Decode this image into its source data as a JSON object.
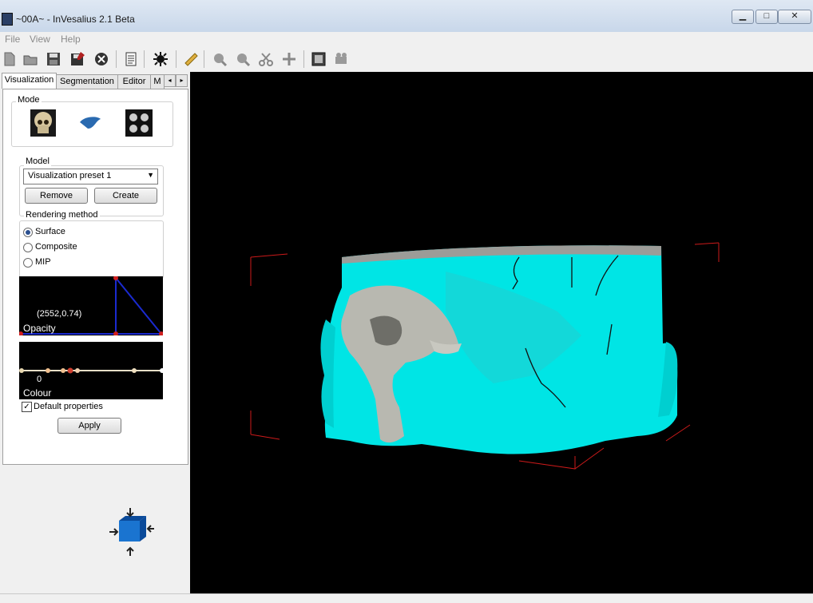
{
  "window": {
    "title": "~00A~ - InVesalius 2.1 Beta",
    "min": "▁",
    "max": "□",
    "close": "✕"
  },
  "menu": [
    "File",
    "View",
    "Help"
  ],
  "tabs": [
    "Visualization",
    "Segmentation",
    "Editor",
    "M"
  ],
  "mode": {
    "label": "Mode"
  },
  "model": {
    "label": "Model",
    "preset": "Visualization preset  1",
    "remove": "Remove",
    "create": "Create"
  },
  "rendering": {
    "label": "Rendering method",
    "options": [
      "Surface",
      "Composite",
      "MIP"
    ],
    "selected": "Surface"
  },
  "opacity": {
    "value": "(2552,0.74)",
    "label": "Opacity"
  },
  "colour": {
    "value": "0",
    "label": "Colour"
  },
  "default_properties": {
    "label": "Default properties",
    "checked": true
  },
  "apply": "Apply",
  "colors": {
    "surface": "#00e5e5",
    "bone": "#b8b8b0",
    "bbox": "#cc1a1a"
  }
}
